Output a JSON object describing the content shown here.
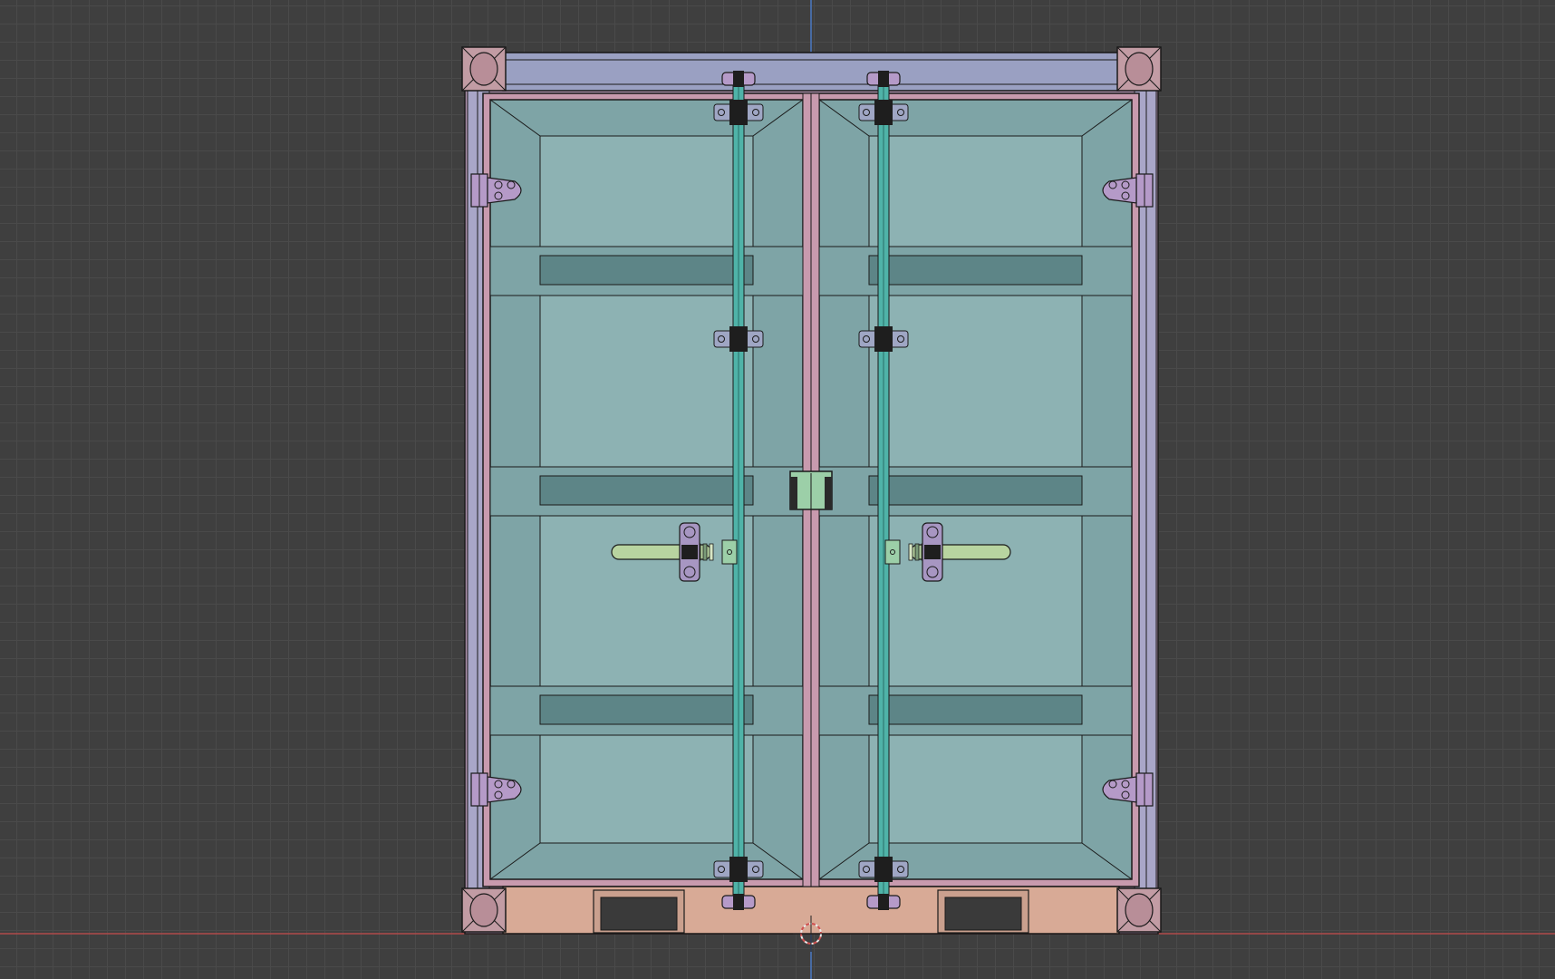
{
  "viewport": {
    "view": "front-orthographic",
    "grid": true,
    "x_axis_color": "#b04a4a",
    "z_axis_color": "#4a78c4"
  },
  "model": {
    "object": "shipping-container-doors",
    "door_count": 2,
    "colors": {
      "door_panel": "#7ea4a6",
      "door_panel_light": "#8db2b3",
      "rib": "#5d8587",
      "frame": "#c89aae",
      "frame_inner": "#a98ea8",
      "top_rail": "#9aa0c2",
      "corner_casting": "#c29ca4",
      "bottom_rail": "#d8aa96",
      "hinge": "#b59ac8",
      "lock_bar": "#4fb3a8",
      "handle": "#b8d4a0",
      "bracket_black": "#1e1e1e",
      "outline": "#1a1a1a"
    }
  }
}
